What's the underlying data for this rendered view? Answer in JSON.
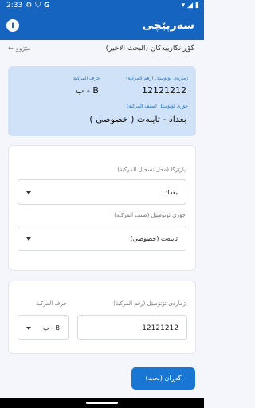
{
  "status_bar": {
    "time": "2:33",
    "icons": [
      "settings-icon",
      "shield-icon",
      "google-icon",
      "wifi-icon",
      "signal-icon",
      "battery-icon"
    ]
  },
  "app_bar": {
    "title": "سەرپێچی",
    "info_label": "i"
  },
  "sub_header": {
    "title": "گۆڕانكارییەكان (البحث الاخير)",
    "history_label": "مێژوو",
    "history_icon": "arrow-left-icon"
  },
  "result": {
    "plate_number_label": "ژمارەی ئۆتۆمبێل (رقم المركبة)",
    "plate_number": "12121212",
    "plate_letter_label": "حرف المركبة",
    "plate_letter": "ب - B",
    "vehicle_type_label": "جۆری ئۆتۆمبێل (صنف المركبة)",
    "vehicle_type": "بغداد - تايبەت ( خصوصي )"
  },
  "form": {
    "province_label": "پارێزگا (محل تسجيل المركبة)",
    "province_value": "بغداد",
    "type_label": "جۆری ئۆتۆمبێل (صنف المركبة)",
    "type_value": "تايبەت (خصوصي)",
    "plate_number_label": "ژمارەی ئۆتۆمبێل (رقم المركبة)",
    "plate_number_value": "12121212",
    "plate_letter_label": "حرف المركبة",
    "plate_letter_value": "ب - B"
  },
  "actions": {
    "search_label": "گەڕان (بحث)"
  },
  "colors": {
    "primary": "#1565c0",
    "accent": "#1976d2",
    "result_bg": "#cfe2f8",
    "label_blue": "#1e73c6"
  }
}
